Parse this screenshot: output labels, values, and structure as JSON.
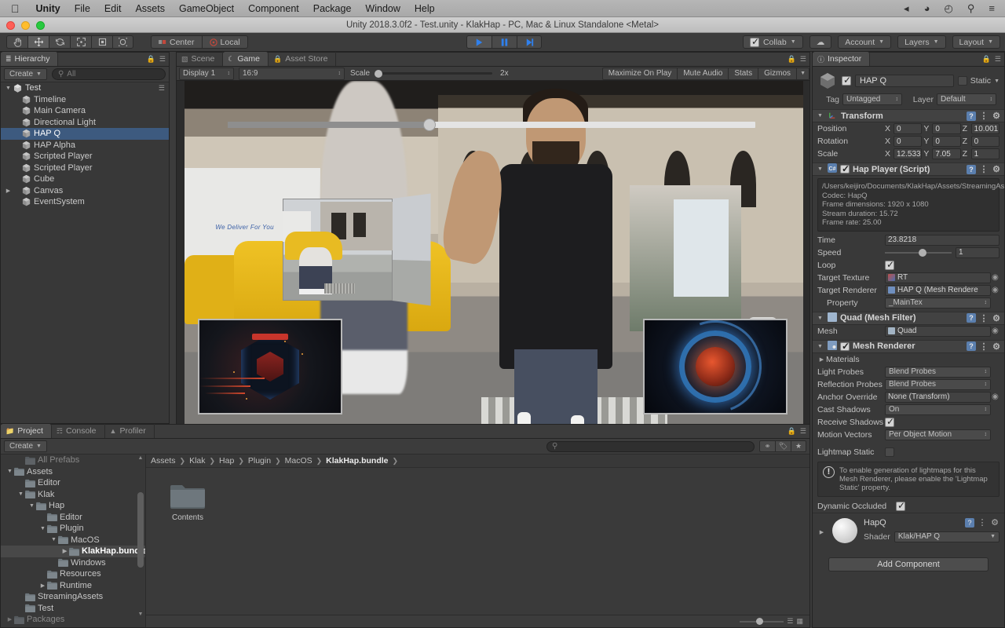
{
  "macmenu": {
    "apple_icon": "apple-icon",
    "items": [
      "Unity",
      "File",
      "Edit",
      "Assets",
      "GameObject",
      "Component",
      "Package",
      "Window",
      "Help"
    ],
    "status_icons": [
      "airplay-icon",
      "wifi-icon",
      "dropbox-icon",
      "search-icon",
      "control-center-icon"
    ]
  },
  "window": {
    "title": "Unity 2018.3.0f2 - Test.unity - KlakHap - PC, Mac & Linux Standalone <Metal>"
  },
  "toolbar": {
    "tools": [
      {
        "name": "hand-tool",
        "glyph": "✋"
      },
      {
        "name": "move-tool",
        "glyph": "✥"
      },
      {
        "name": "rotate-tool",
        "glyph": "⟳"
      },
      {
        "name": "scale-tool",
        "glyph": "⤢"
      },
      {
        "name": "rect-tool",
        "glyph": "▣"
      },
      {
        "name": "transform-tool",
        "glyph": "◈"
      }
    ],
    "pivot": "Center",
    "handle": "Local",
    "play": "▶",
    "pause": "❚❚",
    "step": "▶❙",
    "collab": "Collab",
    "cloud_icon": "cloud-icon",
    "account": "Account",
    "layers": "Layers",
    "layout": "Layout"
  },
  "hierarchy": {
    "tab": "Hierarchy",
    "create": "Create",
    "search_placeholder": "All",
    "root": "Test",
    "items": [
      {
        "label": "Timeline",
        "selected": false,
        "expandable": false
      },
      {
        "label": "Main Camera",
        "selected": false,
        "expandable": false
      },
      {
        "label": "Directional Light",
        "selected": false,
        "expandable": false
      },
      {
        "label": "HAP Q",
        "selected": true,
        "expandable": false
      },
      {
        "label": "HAP Alpha",
        "selected": false,
        "expandable": false
      },
      {
        "label": "Scripted Player",
        "selected": false,
        "expandable": false
      },
      {
        "label": "Scripted Player",
        "selected": false,
        "expandable": false
      },
      {
        "label": "Cube",
        "selected": false,
        "expandable": false
      },
      {
        "label": "Canvas",
        "selected": false,
        "expandable": true
      },
      {
        "label": "EventSystem",
        "selected": false,
        "expandable": false
      }
    ]
  },
  "gameview": {
    "tabs": [
      {
        "label": "Scene",
        "icon": "grid-icon",
        "active": false
      },
      {
        "label": "Game",
        "icon": "gamepad-icon",
        "active": true
      },
      {
        "label": "Asset Store",
        "icon": "store-icon",
        "active": false
      }
    ],
    "display": "Display 1",
    "aspect": "16:9",
    "scale_label": "Scale",
    "scale_value": "2x",
    "maximize_on_play": "Maximize On Play",
    "mute_audio": "Mute Audio",
    "stats": "Stats",
    "gizmos": "Gizmos",
    "video_caption": "We Deliver For You"
  },
  "inspector": {
    "tab": "Inspector",
    "object_name": "HAP Q",
    "enabled": true,
    "static_label": "Static",
    "tag_label": "Tag",
    "tag_value": "Untagged",
    "layer_label": "Layer",
    "layer_value": "Default",
    "transform": {
      "title": "Transform",
      "rows": [
        {
          "label": "Position",
          "x": "0",
          "y": "0",
          "z": "10.001"
        },
        {
          "label": "Rotation",
          "x": "0",
          "y": "0",
          "z": "0"
        },
        {
          "label": "Scale",
          "x": "12.5333",
          "y": "7.05",
          "z": "1"
        }
      ]
    },
    "hap_player": {
      "title": "Hap Player (Script)",
      "enabled": true,
      "info": "/Users/keijiro/Documents/KlakHap/Assets/StreamingAssets/HapQ.mov\nCodec: HapQ\nFrame dimensions: 1920 x 1080\nStream duration: 15.72\nFrame rate: 25.00",
      "time_label": "Time",
      "time_value": "23.8218",
      "speed_label": "Speed",
      "speed_value": "1",
      "loop_label": "Loop",
      "loop_checked": true,
      "target_texture_label": "Target Texture",
      "target_texture_value": "RT",
      "target_renderer_label": "Target Renderer",
      "target_renderer_value": "HAP Q (Mesh Rendere",
      "property_label": "Property",
      "property_value": "_MainTex"
    },
    "mesh_filter": {
      "title": "Quad (Mesh Filter)",
      "mesh_label": "Mesh",
      "mesh_value": "Quad"
    },
    "mesh_renderer": {
      "title": "Mesh Renderer",
      "enabled": true,
      "materials_label": "Materials",
      "rows": [
        {
          "label": "Light Probes",
          "value": "Blend Probes",
          "type": "dropdown"
        },
        {
          "label": "Reflection Probes",
          "value": "Blend Probes",
          "type": "dropdown"
        },
        {
          "label": "Anchor Override",
          "value": "None (Transform)",
          "type": "object"
        },
        {
          "label": "Cast Shadows",
          "value": "On",
          "type": "dropdown"
        },
        {
          "label": "Receive Shadows",
          "value": "",
          "type": "checkbox",
          "checked": true
        },
        {
          "label": "Motion Vectors",
          "value": "Per Object Motion",
          "type": "dropdown"
        }
      ],
      "lightmap_static_label": "Lightmap Static",
      "lightmap_static_checked": false,
      "warning": "To enable generation of lightmaps for this Mesh Renderer, please enable the 'Lightmap Static' property.",
      "dynamic_occluded_label": "Dynamic Occluded",
      "dynamic_occluded_checked": true
    },
    "material": {
      "name": "HapQ",
      "shader_label": "Shader",
      "shader_value": "Klak/HAP Q"
    },
    "add_component": "Add Component"
  },
  "project": {
    "tabs": [
      {
        "label": "Project",
        "icon": "folder-icon",
        "active": true
      },
      {
        "label": "Console",
        "icon": "console-icon",
        "active": false
      },
      {
        "label": "Profiler",
        "icon": "profiler-icon",
        "active": false
      }
    ],
    "create": "Create",
    "search_placeholder": "",
    "tree": [
      {
        "label": "All Prefabs",
        "depth": 1,
        "arrow": "",
        "selected": false,
        "clipped": true
      },
      {
        "label": "Assets",
        "depth": 0,
        "arrow": "▼",
        "selected": false
      },
      {
        "label": "Editor",
        "depth": 1,
        "arrow": "",
        "selected": false
      },
      {
        "label": "Klak",
        "depth": 1,
        "arrow": "▼",
        "selected": false
      },
      {
        "label": "Hap",
        "depth": 2,
        "arrow": "▼",
        "selected": false
      },
      {
        "label": "Editor",
        "depth": 3,
        "arrow": "",
        "selected": false
      },
      {
        "label": "Plugin",
        "depth": 3,
        "arrow": "▼",
        "selected": false
      },
      {
        "label": "MacOS",
        "depth": 4,
        "arrow": "▼",
        "selected": false
      },
      {
        "label": "KlakHap.bundle",
        "depth": 5,
        "arrow": "▶",
        "selected": true
      },
      {
        "label": "Windows",
        "depth": 4,
        "arrow": "",
        "selected": false
      },
      {
        "label": "Resources",
        "depth": 3,
        "arrow": "",
        "selected": false
      },
      {
        "label": "Runtime",
        "depth": 3,
        "arrow": "▶",
        "selected": false
      },
      {
        "label": "StreamingAssets",
        "depth": 1,
        "arrow": "",
        "selected": false
      },
      {
        "label": "Test",
        "depth": 1,
        "arrow": "",
        "selected": false
      },
      {
        "label": "Packages",
        "depth": 0,
        "arrow": "▶",
        "selected": false,
        "clipped": true
      }
    ],
    "breadcrumbs": [
      "Assets",
      "Klak",
      "Hap",
      "Plugin",
      "MacOS",
      "KlakHap.bundle"
    ],
    "assets": [
      {
        "label": "Contents",
        "icon": "folder-icon"
      }
    ],
    "filter_icons": [
      "favorite-icon",
      "label-icon",
      "star-icon"
    ]
  }
}
